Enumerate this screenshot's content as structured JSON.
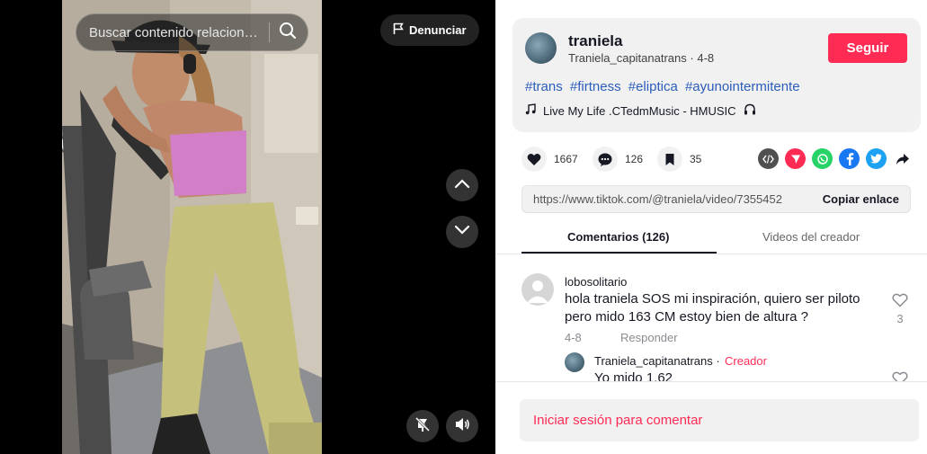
{
  "video": {
    "search_placeholder": "Buscar contenido relacionado",
    "report_label": "Denunciar"
  },
  "author": {
    "name": "traniela",
    "handle": "Traniela_capitanatrans",
    "date": "4-8",
    "follow_label": "Seguir"
  },
  "description": {
    "hashtags": [
      "#trans",
      "#firtness",
      "#eliptica",
      "#ayunointermitente"
    ],
    "music": "Live My Life .CTedmMusic - HMUSIC"
  },
  "stats": {
    "likes": "1667",
    "comments": "126",
    "saves": "35"
  },
  "share_icons": [
    {
      "name": "embed-icon",
      "color": "#505050"
    },
    {
      "name": "send-icon",
      "color": "#fe2c55"
    },
    {
      "name": "whatsapp-icon",
      "color": "#25d366"
    },
    {
      "name": "facebook-icon",
      "color": "#1877f2"
    },
    {
      "name": "twitter-icon",
      "color": "#1da1f2"
    },
    {
      "name": "share-arrow-icon",
      "color": "#161823"
    }
  ],
  "link": {
    "url": "https://www.tiktok.com/@traniela/video/7355452",
    "copy_label": "Copiar enlace"
  },
  "tabs": {
    "comments_label": "Comentarios (126)",
    "creator_videos_label": "Videos del creador"
  },
  "comments": [
    {
      "user": "lobosolitario",
      "text": "hola traniela SOS mi inspiración, quiero ser piloto pero mido 163 CM estoy bien de altura ?",
      "date": "4-8",
      "reply_label": "Responder",
      "likes": "3",
      "reply": {
        "user": "Traniela_capitanatrans",
        "separator": "·",
        "badge": "Creador",
        "text": "Yo mido 1.62"
      }
    }
  ],
  "login_prompt": "Iniciar sesión para comentar",
  "colors": {
    "accent": "#fe2c55",
    "hashtag": "#2b5db9",
    "panel_bg": "#f1f1f2"
  }
}
